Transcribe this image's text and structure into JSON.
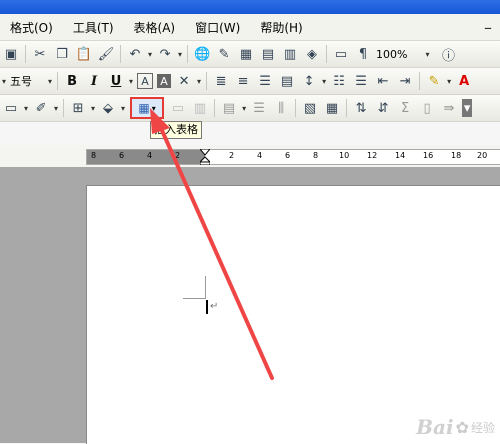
{
  "menubar": {
    "items": [
      "格式(O)",
      "工具(T)",
      "表格(A)",
      "窗口(W)",
      "帮助(H)"
    ]
  },
  "toolbar": {
    "zoom": "100%",
    "font_size": "五号",
    "bold": "B",
    "italic": "I",
    "underline": "U",
    "char_border": "A",
    "char_shade": "A",
    "sum": "Σ"
  },
  "tooltip": {
    "insert_table": "插入表格"
  },
  "ruler": {
    "labels_left": [
      "8",
      "6",
      "4",
      "2"
    ],
    "labels_right": [
      "2",
      "4",
      "6",
      "8",
      "10",
      "12",
      "14",
      "16",
      "18",
      "20"
    ]
  },
  "document": {
    "paragraph_mark": "↵"
  },
  "watermark": {
    "logo": "Bai",
    "sub": "经验"
  },
  "colors": {
    "highlight_border": "#e53935",
    "arrow": "#f04545",
    "tooltip_bg": "#ffffe1"
  }
}
